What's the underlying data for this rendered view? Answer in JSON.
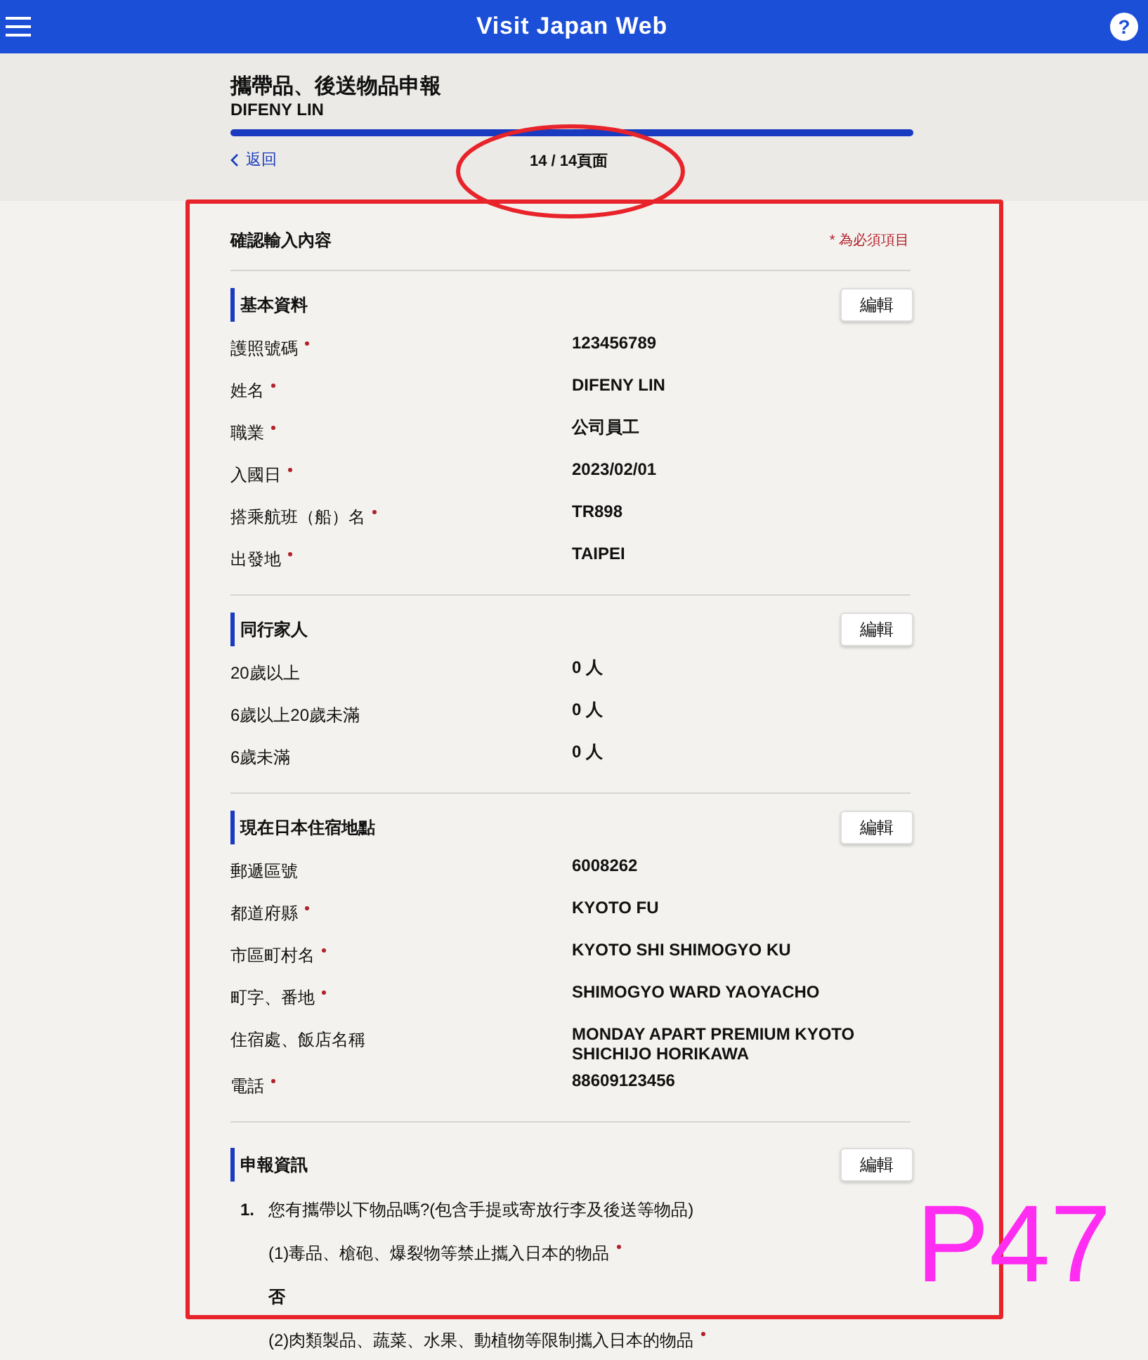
{
  "header": {
    "title": "Visit Japan Web",
    "help": "?"
  },
  "page": {
    "title": "攜帶品、後送物品申報",
    "name": "DIFENY LIN",
    "progress": {
      "level": 1
    },
    "back": "返回",
    "page_count": "14 / 14頁面"
  },
  "confirm": {
    "title": "確認輸入內容",
    "required_note": "* 為必須項目"
  },
  "sections": [
    {
      "title": "基本資料",
      "edit": "編輯",
      "kind": "fields",
      "fields": [
        {
          "label": "護照號碼",
          "required": true,
          "value": "123456789"
        },
        {
          "label": "姓名",
          "required": true,
          "value": "DIFENY LIN"
        },
        {
          "label": "職業",
          "required": true,
          "value": "公司員工"
        },
        {
          "label": "入國日",
          "required": true,
          "value": "2023/02/01"
        },
        {
          "label": "搭乘航班（船）名",
          "required": true,
          "value": "TR898"
        },
        {
          "label": "出發地",
          "required": true,
          "value": "TAIPEI"
        }
      ]
    },
    {
      "title": "同行家人",
      "edit": "編輯",
      "kind": "fields",
      "fields": [
        {
          "label": "20歲以上",
          "required": false,
          "value": "0 人"
        },
        {
          "label": "6歲以上20歲未滿",
          "required": false,
          "value": "0 人"
        },
        {
          "label": "6歲未滿",
          "required": false,
          "value": "0 人"
        }
      ]
    },
    {
      "title": "現在日本住宿地點",
      "edit": "編輯",
      "kind": "fields",
      "fields": [
        {
          "label": "郵遞區號",
          "required": false,
          "value": "6008262"
        },
        {
          "label": "都道府縣",
          "required": true,
          "value": "KYOTO FU"
        },
        {
          "label": "市區町村名",
          "required": true,
          "value": "KYOTO SHI SHIMOGYO KU"
        },
        {
          "label": "町字、番地",
          "required": true,
          "value": "SHIMOGYO WARD YAOYACHO"
        },
        {
          "label": "住宿處、飯店名稱",
          "required": false,
          "value": "MONDAY APART PREMIUM KYOTO SHICHIJO HORIKAWA"
        },
        {
          "label": "電話",
          "required": true,
          "value": "88609123456"
        }
      ]
    },
    {
      "title": "申報資訊",
      "edit": "編輯",
      "kind": "questions",
      "questions": [
        {
          "number": "1.",
          "text": "您有攜帶以下物品嗎?(包含手提或寄放行李及後送等物品)",
          "items": [
            {
              "text": "(1)毒品、槍砲、爆裂物等禁止攜入日本的物品",
              "required": true,
              "answer": "否"
            },
            {
              "text": "(2)肉類製品、蔬菜、水果、動植物等限制攜入日本的物品",
              "required": true
            }
          ]
        }
      ]
    }
  ],
  "annotation": {
    "label": "P47"
  }
}
